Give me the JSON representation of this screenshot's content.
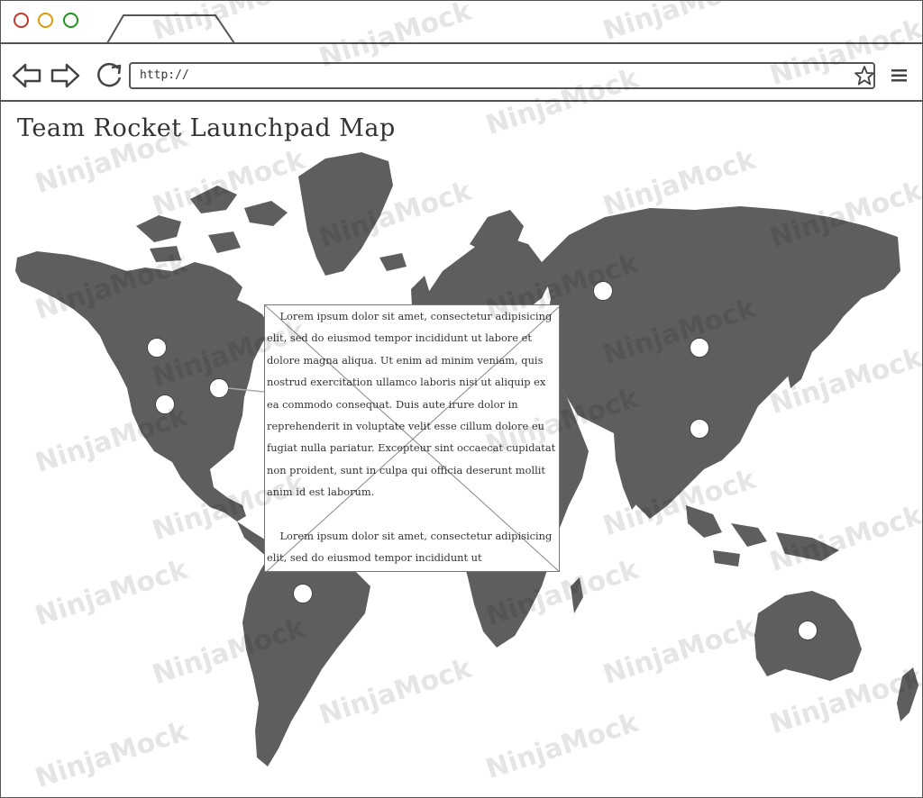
{
  "browser": {
    "url": "http://",
    "tab_label": ""
  },
  "page": {
    "title": "Team Rocket Launchpad Map"
  },
  "popup": {
    "text": "    Lorem ipsum dolor sit amet, consectetur adipisicing elit, sed do eiusmod tempor incididunt ut labore et dolore magna aliqua. Ut enim ad minim veniam, quis nostrud exercitation ullamco laboris nisi ut aliquip ex ea commodo consequat. Duis aute irure dolor in reprehenderit in voluptate velit esse cillum dolore eu fugiat nulla pariatur. Excepteur sint occaecat cupidatat non proident, sunt in culpa qui officia deserunt mollit anim id est laborum.\n\n    Lorem ipsum dolor sit amet, consectetur adipisicing elit, sed do eiusmod tempor incididunt ut"
  },
  "watermark": {
    "text": "NinjaMock"
  },
  "colors": {
    "land": "#5e5e5e",
    "border": "#555555",
    "dot_red": "#c0392b",
    "dot_orange": "#e09a00",
    "dot_green": "#1a9a1a"
  }
}
